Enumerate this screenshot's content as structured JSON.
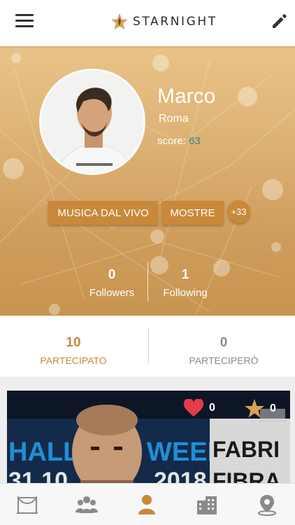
{
  "app": {
    "name": "STARNIGHT"
  },
  "colors": {
    "accent": "#c8893a",
    "score": "#3a7f86",
    "inactive": "#8a8a8a"
  },
  "profile": {
    "name": "Marco",
    "city": "Roma",
    "score_label": "score:",
    "score_value": "63"
  },
  "tags": [
    "MUSICA DAL VIVO",
    "MOSTRE"
  ],
  "tags_more": "+33",
  "stats": {
    "followers": {
      "count": "0",
      "label": "Followers"
    },
    "following": {
      "count": "1",
      "label": "Following"
    }
  },
  "participation": {
    "partecipato": {
      "count": "10",
      "label": "PARTECIPATO"
    },
    "parteciperò": {
      "count": "0",
      "label": "PARTECIPERÒ"
    }
  },
  "event_card": {
    "likes": "0",
    "venue_count": "0"
  },
  "icons": {
    "menu": "hamburger-icon",
    "edit": "pencil-icon",
    "nav": [
      "events-icon",
      "community-icon",
      "profile-icon",
      "venues-icon",
      "map-pin-icon"
    ]
  },
  "bottom_nav_active": 2
}
